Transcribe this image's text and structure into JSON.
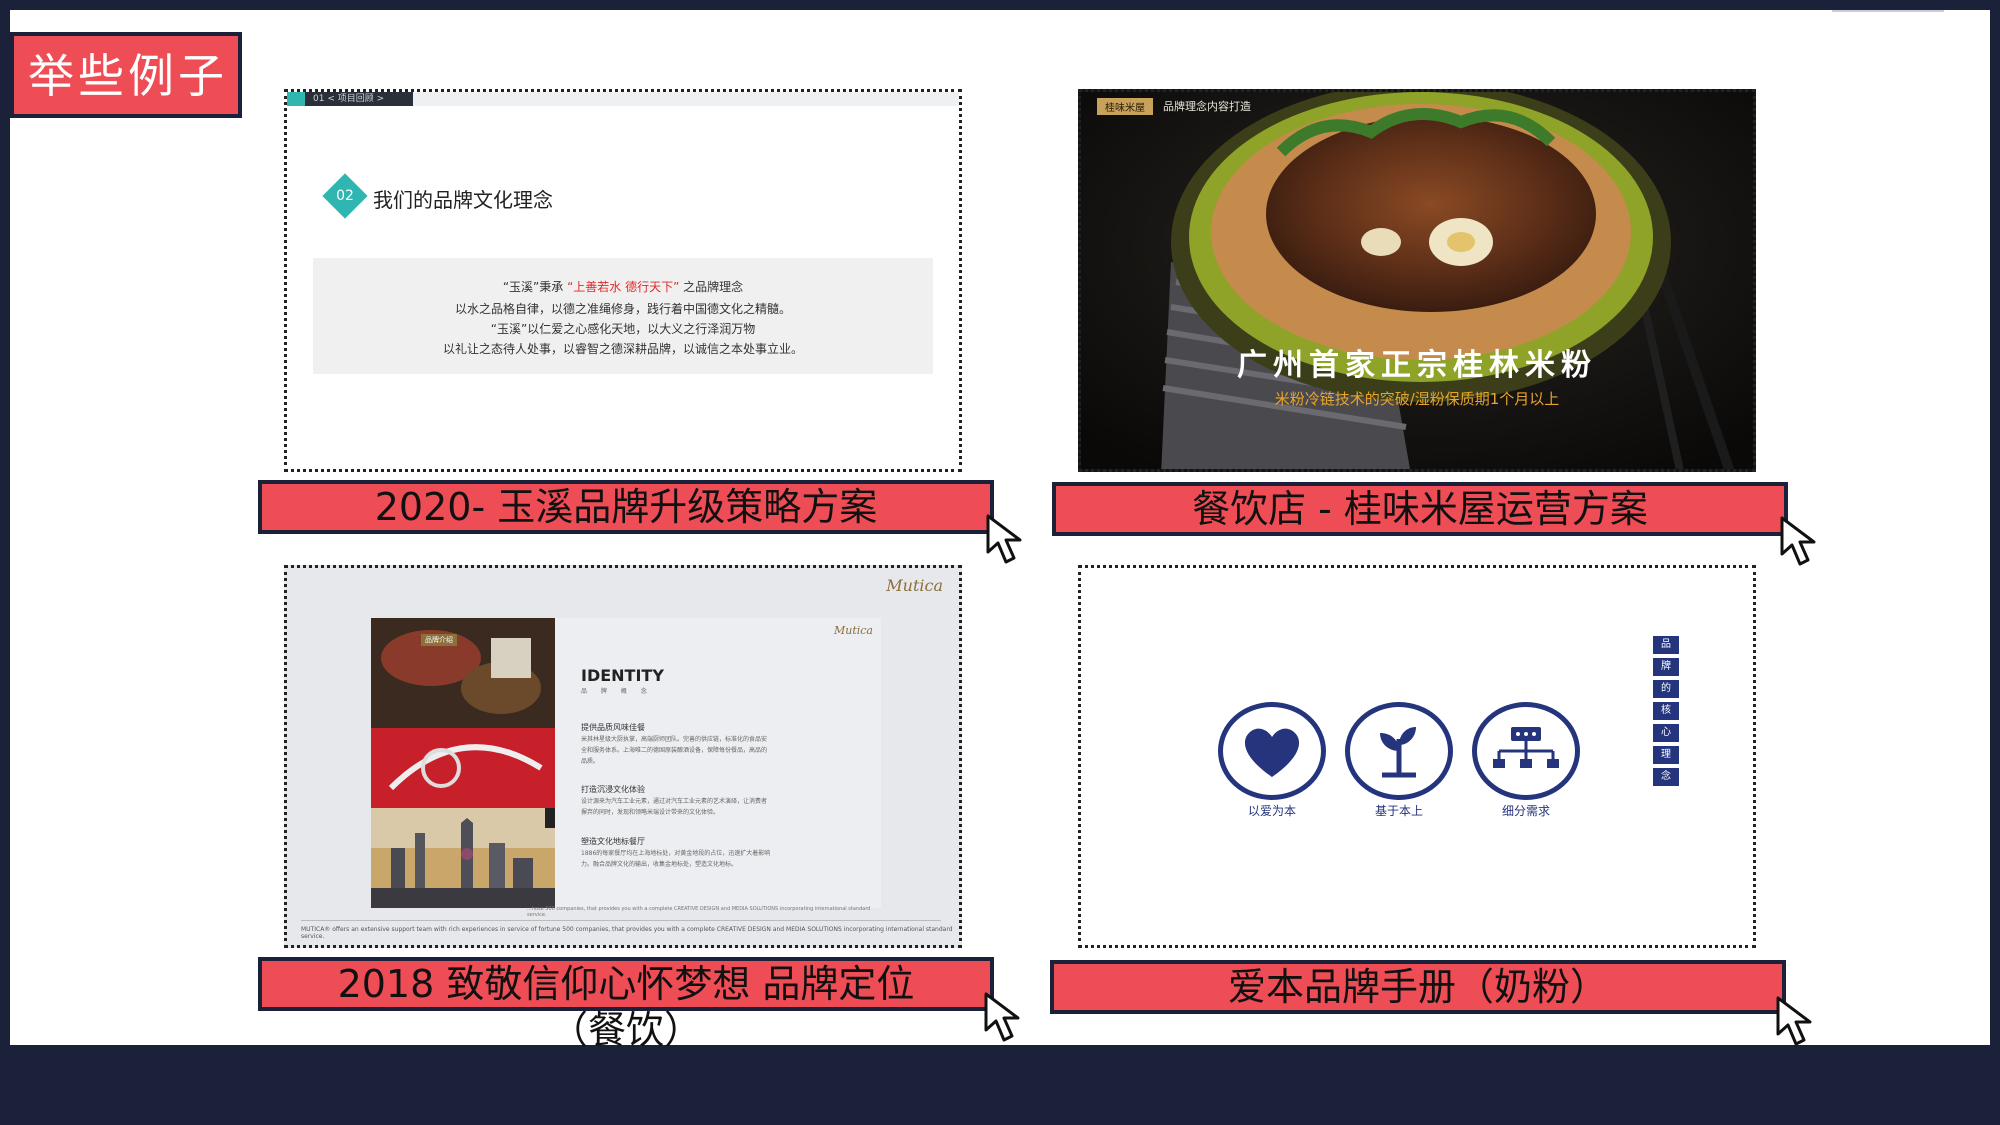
{
  "slide_title": "举些例子",
  "colors": {
    "accent": "#ee4d56",
    "navy": "#1b2138",
    "teal": "#2fb6b0",
    "brand_blue": "#24347d",
    "gold": "#e8a52c"
  },
  "cards": [
    {
      "label": "2020- 玉溪品牌升级策略方案",
      "tab": "01 < 项目回顾 >",
      "num": "02",
      "heading": "我们的品牌文化理念",
      "lines": [
        {
          "pre": "“玉溪”秉承 ",
          "red": "“上善若水 德行天下”",
          "post": " 之品牌理念"
        },
        {
          "pre": "以水之品格自律，以德之准绳修身，践行着中国德文化之精髓。",
          "red": "",
          "post": ""
        },
        {
          "pre": "“玉溪”以仁爱之心感化天地，以大义之行泽润万物",
          "red": "",
          "post": ""
        },
        {
          "pre": "以礼让之态待人处事，以睿智之德深耕品牌，以诚信之本处事立业。",
          "red": "",
          "post": ""
        }
      ]
    },
    {
      "label": "餐饮店 - 桂味米屋运营方案",
      "brand": "桂味米屋",
      "brand_note": "品牌理念内容打造",
      "main": "广州首家正宗桂林米粉",
      "sub": "米粉冷链技术的突破/湿粉保质期1个月以上"
    },
    {
      "label": "2018 致敬信仰心怀梦想 品牌定位（餐饮）",
      "logo": "Mutica",
      "tag": "品牌介绍",
      "identity": "IDENTITY",
      "identity_sub": "品 牌 概 念",
      "sections": [
        {
          "title": "提供品质风味佳餐",
          "text": "米其林星级大厨执掌，高端厨师团队。完善的供应链，标准化的食品安全和服务体系。上海唯二的德国原装酿酒设备，保障每份餐品，高品的品质。"
        },
        {
          "title": "打造沉浸文化体验",
          "text": "设计源来为汽车工业元素，通过对汽车工业元素的艺术演绎，让消费者摒弃的同时，发现和领略米瑞设计带来的文化体验。"
        },
        {
          "title": "塑造文化地标餐厅",
          "text": "1886的每家餐厅均在上海地标处，对黄金地段的占位，迅速扩大着影响力。融合品牌文化的输出，收集金地标处，塑造文化地标。"
        }
      ],
      "page_footer": "...hose 500 companies, that provides you with a complete CREATIVE DESIGN and MEDIA SOLUTIONS incorporating international standard service.",
      "footer": "MUTICA® offers an extensive support team with rich experiences in service of fortune 500 companies, that provides you with a complete CREATIVE DESIGN and MEDIA SOLUTIONS incorporating international standard service."
    },
    {
      "label": "爱本品牌手册（奶粉）",
      "icons": [
        {
          "name": "heart-icon",
          "caption": "以爱为本"
        },
        {
          "name": "sprout-icon",
          "caption": "基于本上"
        },
        {
          "name": "org-chart-icon",
          "caption": "细分需求"
        }
      ],
      "vertical": [
        "品",
        "牌",
        "的",
        "核",
        "心",
        "理",
        "念"
      ]
    }
  ]
}
